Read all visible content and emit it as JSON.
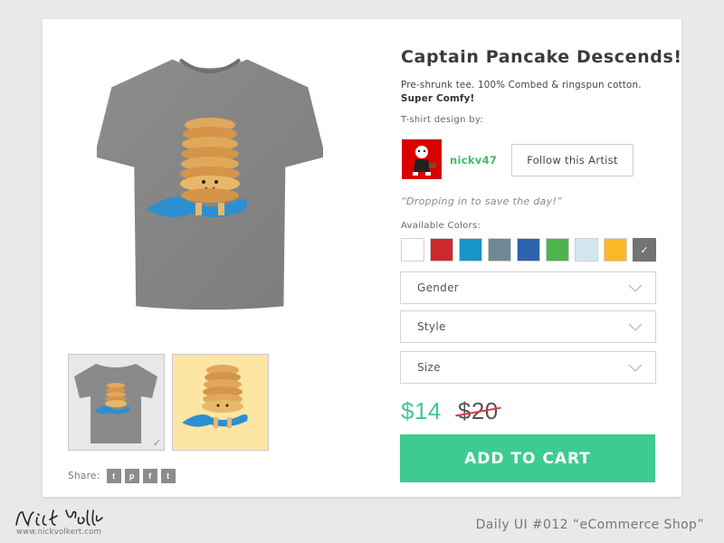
{
  "product": {
    "title": "Captain Pancake Descends!",
    "description": "Pre-shrunk tee. 100% Combed & ringspun cotton.",
    "description_bold": "Super Comfy!",
    "designer_label": "T-shirt design by:",
    "tagline": "“Dropping in to save the day!”"
  },
  "artist": {
    "name": "nickv47",
    "follow_label": "Follow this Artist"
  },
  "colors": {
    "label": "Available Colors:",
    "swatches": [
      {
        "name": "white",
        "hex": "#ffffff"
      },
      {
        "name": "red",
        "hex": "#cc2a2a"
      },
      {
        "name": "cyan",
        "hex": "#1895c8"
      },
      {
        "name": "slate",
        "hex": "#6f8796"
      },
      {
        "name": "blue",
        "hex": "#2e62ad"
      },
      {
        "name": "green",
        "hex": "#4db34d"
      },
      {
        "name": "light-blue",
        "hex": "#d1e6f0"
      },
      {
        "name": "yellow",
        "hex": "#fbb724"
      },
      {
        "name": "grey",
        "hex": "#737373",
        "selected": true
      }
    ]
  },
  "selects": {
    "gender": "Gender",
    "style": "Style",
    "size": "Size"
  },
  "price": {
    "current": "$14",
    "original": "$20"
  },
  "cart": {
    "label": "ADD TO CART"
  },
  "share": {
    "label": "Share:",
    "buttons": [
      "twitter",
      "pinterest",
      "facebook",
      "tumblr"
    ]
  },
  "footer": {
    "signature": "Nick Volkert",
    "site": "www.nickvolkert.com",
    "caption": "Daily UI #012 “eCommerce Shop”"
  },
  "theme": {
    "accent": "#3dcb91",
    "artist_green": "#3dbb6b",
    "strike_red": "#e23b3b"
  }
}
